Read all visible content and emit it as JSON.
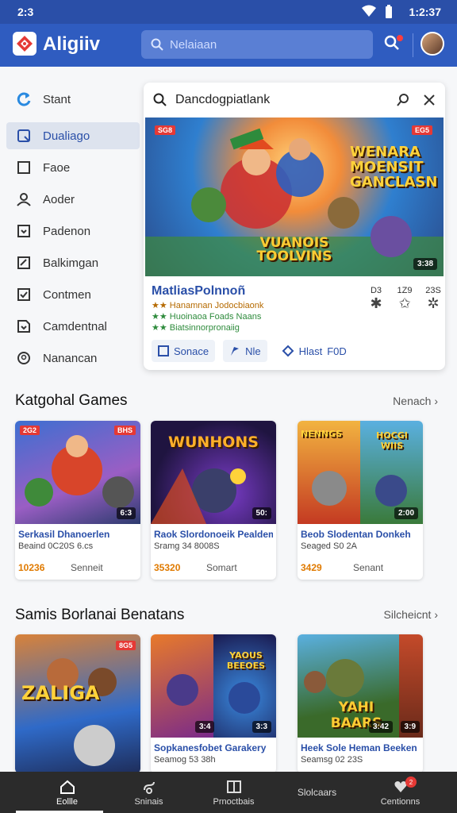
{
  "status": {
    "time": "2:3",
    "clock": "1:2:37"
  },
  "appbar": {
    "title": "Aligiiv",
    "search_placeholder": "Nelaiaan"
  },
  "sidebar": {
    "items": [
      {
        "label": "Stant",
        "icon": "refresh-icon"
      },
      {
        "label": "Dualiago",
        "icon": "document-icon"
      },
      {
        "label": "Faoe",
        "icon": "square-icon"
      },
      {
        "label": "Aoder",
        "icon": "user-icon"
      },
      {
        "label": "Padenon",
        "icon": "download-icon"
      },
      {
        "label": "Balkimgan",
        "icon": "chart-icon"
      },
      {
        "label": "Contmen",
        "icon": "checkbox-icon"
      },
      {
        "label": "Camdentnal",
        "icon": "doc-download-icon"
      },
      {
        "label": "Nanancan",
        "icon": "location-icon"
      }
    ]
  },
  "featured": {
    "query": "Dancdogpiatlank",
    "badge_left": "SG8",
    "badge_right": "EG5",
    "hero_title_right": "WENARA MOENSIT GANCLASN",
    "hero_title_bottom": "VUANOIS TOOLVINS",
    "hero_badge": "3:38",
    "title": "MatliasPolnnoñ",
    "meta": [
      "Hanamnan Jodocbiaonk",
      "Huoinaoa Foads Naans",
      "Biatsinnorpronaiig"
    ],
    "stats": [
      {
        "value": "D3"
      },
      {
        "value": "1Z9"
      },
      {
        "value": "23S"
      }
    ],
    "actions": [
      "Sonace",
      "Nle",
      "Hlast",
      "F0D"
    ]
  },
  "section1": {
    "title": "Katgohal Games",
    "more": "Nenach",
    "cards": [
      {
        "title": "Serkasil Dhanoerlen",
        "sub": "Beaind 0C20S 6.cs",
        "rating": "10236",
        "price": "Senneit",
        "badge": "2G2",
        "badge2": "BHS",
        "time": "6:3"
      },
      {
        "title": "Raok Slordonoeik Pealdem",
        "sub": "Sramg 34 8008S",
        "rating": "35320",
        "price": "Somart",
        "banner": "WUNHONS",
        "time": "50:"
      },
      {
        "title": "Beob Slodentan Donkeh",
        "sub": "Seaged S0 2A",
        "rating": "3429",
        "price": "Senant",
        "banner": "NENNGS",
        "banner2": "HOCGI WIIS",
        "time": "2:00"
      }
    ]
  },
  "section2": {
    "title": "Samis Borlanai Benatans",
    "more": "Silcheicnt",
    "cards": [
      {
        "title": "",
        "sub": "",
        "banner": "ZALIGA",
        "badge": "8G5"
      },
      {
        "title": "Sopkanesfobet Garakery",
        "sub": "Seamog 53 38h",
        "banner": "YAOUS BEEOES",
        "time": "3:4",
        "time2": "3:3"
      },
      {
        "title": "Heek Sole Heman Beeken",
        "sub": "Seamsg 02 23S",
        "banner": "YAHI BAARS",
        "time": "3:42",
        "time2": "3:9"
      }
    ]
  },
  "bottomnav": {
    "items": [
      {
        "label": "Eollle",
        "icon": "home-icon"
      },
      {
        "label": "Sninais",
        "icon": "link-icon"
      },
      {
        "label": "Prnoctbais",
        "icon": "gallery-icon"
      },
      {
        "label": "Slolcaars",
        "icon": ""
      },
      {
        "label": "Centionns",
        "icon": "heart-icon",
        "badge": "2"
      }
    ]
  },
  "colors": {
    "appbar": "#2f5cc0",
    "accent": "#2a4fa8",
    "rating": "#e07a00"
  }
}
